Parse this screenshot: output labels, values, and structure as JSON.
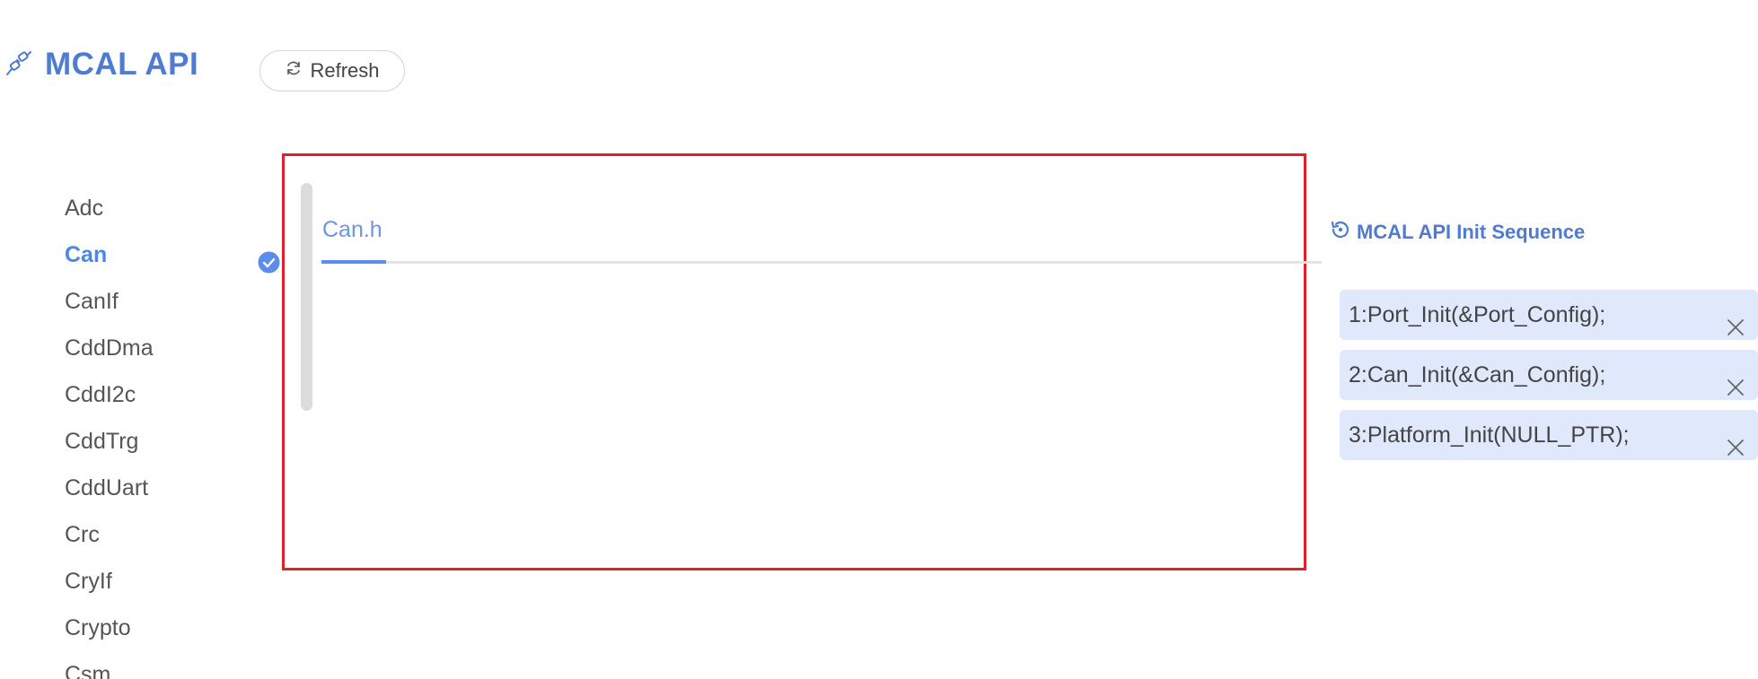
{
  "header": {
    "title": "MCAL API",
    "logo_icon": "plug-icon",
    "refresh_label": "Refresh",
    "accent_color": "#4f7bd0"
  },
  "sidebar": {
    "items": [
      {
        "label": "Adc",
        "active": false
      },
      {
        "label": "Can",
        "active": true
      },
      {
        "label": "CanIf",
        "active": false
      },
      {
        "label": "CddDma",
        "active": false
      },
      {
        "label": "CddI2c",
        "active": false
      },
      {
        "label": "CddTrg",
        "active": false
      },
      {
        "label": "CddUart",
        "active": false
      },
      {
        "label": "Crc",
        "active": false
      },
      {
        "label": "CryIf",
        "active": false
      },
      {
        "label": "Crypto",
        "active": false
      },
      {
        "label": "Csm",
        "active": false
      }
    ],
    "active_color": "#4f86e6"
  },
  "main": {
    "tabs": [
      {
        "label": "Can.h",
        "active": true
      }
    ],
    "highlight_border_color": "#e0202a"
  },
  "init_sequence": {
    "title": "MCAL API Init Sequence",
    "items": [
      {
        "label": "1:Port_Init(&Port_Config);"
      },
      {
        "label": "2:Can_Init(&Can_Config);"
      },
      {
        "label": "3:Platform_Init(NULL_PTR);"
      }
    ],
    "item_background": "#dfe9fb"
  }
}
